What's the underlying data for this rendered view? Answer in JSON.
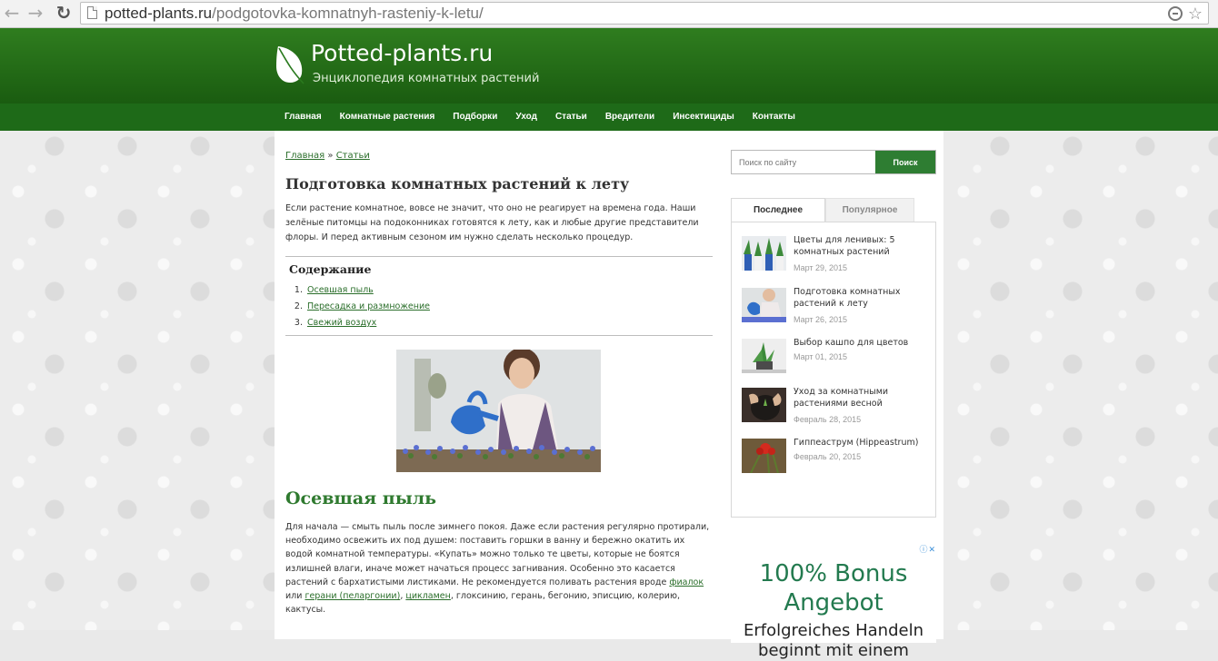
{
  "browser": {
    "url_host": "potted-plants.ru",
    "url_path": "/podgotovka-komnatnyh-rasteniy-k-letu/"
  },
  "site": {
    "title": "Potted-plants.ru",
    "subtitle": "Энциклопедия комнатных растений"
  },
  "menu": [
    "Главная",
    "Комнатные растения",
    "Подборки",
    "Уход",
    "Статьи",
    "Вредители",
    "Инсектициды",
    "Контакты"
  ],
  "breadcrumb": {
    "home": "Главная",
    "sep": "»",
    "current": "Статьи"
  },
  "article": {
    "title": "Подготовка комнатных растений к лету",
    "intro": "Если растение комнатное, вовсе не значит, что оно не реагирует на времена года. Наши зелёные питомцы на подоконниках готовятся к лету, как и любые другие представители флоры. И перед активным сезоном им нужно сделать несколько процедур.",
    "toc_title": "Содержание",
    "toc": [
      "Осевшая пыль",
      "Пересадка и размножение",
      "Свежий воздух"
    ],
    "section_title": "Осевшая пыль",
    "p1": "Для начала — смыть пыль после зимнего покоя. Даже если растения регулярно протирали, необходимо освежить их под душем: поставить горшки в ванну и бережно окатить их водой комнатной температуры. «Купать» можно только те цветы, которые не боятся излишней влаги, иначе может начаться процесс загнивания. Особенно это касается растений с бархатистыми листиками. Не рекомендуется поливать растения вроде ",
    "link1": "фиалок",
    "p2": " или ",
    "link2": "герани (пеларгонии)",
    "p3": ", ",
    "link3": "цикламен",
    "p4": ", глоксинию, герань, бегонию, эписцию, колерию, кактусы."
  },
  "sidebar": {
    "search_placeholder": "Поиск по сайту",
    "search_button": "Поиск",
    "tab_recent": "Последнее",
    "tab_popular": "Популярное",
    "posts": [
      {
        "title": "Цветы для ленивых: 5 комнатных растений",
        "date": "Март 29, 2015"
      },
      {
        "title": "Подготовка комнатных растений к лету",
        "date": "Март 26, 2015"
      },
      {
        "title": "Выбор кашпо для цветов",
        "date": "Март 01, 2015"
      },
      {
        "title": "Уход за комнатными растениями весной",
        "date": "Февраль 28, 2015"
      },
      {
        "title": "Гиппеаструм (Hippeastrum)",
        "date": "Февраль 20, 2015"
      }
    ]
  },
  "ad": {
    "headline_1": "100% Bonus",
    "headline_2": "Angebot",
    "line_1": "Erfolgreiches Handeln",
    "line_2": "beginnt mit einem"
  }
}
